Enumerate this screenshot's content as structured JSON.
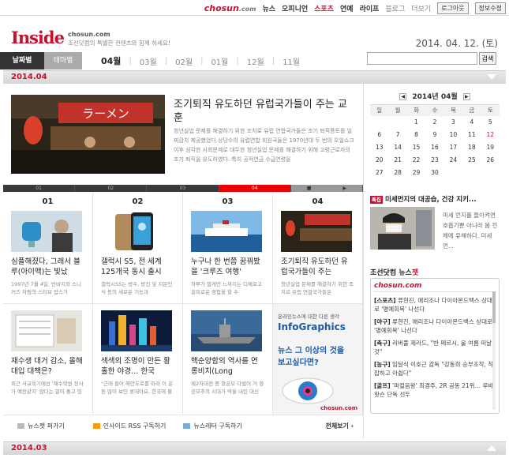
{
  "topbar": {
    "logo_main": "chosun",
    "logo_dot": ".com",
    "nav": [
      "뉴스",
      "오피니언",
      "스포츠",
      "연예",
      "라이프",
      "블로그",
      "더보기"
    ],
    "logout": "로그아웃",
    "profile": "정보수정"
  },
  "header": {
    "brand": "Inside",
    "site": "chosun.com",
    "tagline": "조선닷컴의 특별한 컨텐츠와 함께 하세요!",
    "date": "2014. 04. 12. (토)"
  },
  "tabs": {
    "by_date": "날짜별",
    "by_theme": "테마별",
    "months": [
      "04월",
      "03월",
      "02월",
      "01월",
      "12월",
      "11월"
    ],
    "active_month": "04월",
    "search_placeholder": "",
    "search_button": "검색"
  },
  "section1": {
    "label": "2014.04"
  },
  "feature": {
    "title": "조기퇴직 유도하던 유럽국가들이 주는 교훈",
    "desc": "청년실업 문제를 해결하기 위한 조치로 유럽 연합국가들은 조기 퇴직풍토를 일찌감치 제공했었다.상당수의 유럽연합 회원국들은 1970년대 두 번의 오일쇼크 이후 심각한 사회문제로 대두한 청년실업 문제를 해결하기 위해 고령근로자의 조기 퇴직을 유도하였다. 특히 공적연금 수급연령을"
  },
  "pager": [
    "01",
    "02",
    "03",
    "04",
    "■",
    "▶"
  ],
  "pager_active": 3,
  "articles": [
    {
      "num": "01",
      "title": "심플해졌다, 그래서 블루(아이맥)는 빛났",
      "desc": "1997년 7월 4일, 빈바지와 스니커즈 차림의 스티브 잡스가"
    },
    {
      "num": "02",
      "title": "갤럭시 S5, 전 세계 125개국 동시 출시",
      "desc": "갤럭시S5는 방수, 방진 및 지문인식 등의 새로운 기능과"
    },
    {
      "num": "03",
      "title": "누구나 한 번쯤 꿈꿔봤을 '크루즈 여행'",
      "desc": "하루가 멀게만 느껴지는 디채로고 흥미로운 경험을 할 수"
    },
    {
      "num": "04",
      "title": "조기퇴직 유도하던 유럽국가들이 주는",
      "desc": "청년실업 문제를 해결하기 위한 조치로 유럽 연합국가들은"
    },
    {
      "num": "",
      "title": "재수생 대거 감소, 올해 대입 대책은?",
      "desc": "최근 사교육기에선 '재수학원 장사가 예전같지' 않다는 말이 돌고 있다 정시 추가합격자가"
    },
    {
      "num": "",
      "title": "색색의 조명이 만든 황홀한 야경… 한국",
      "desc": "\"근래 들어 해안도로를 따라 이 운동 많이 보인 롯데아요, 한국에 불어 오는 생선 밀린 곧"
    },
    {
      "num": "",
      "title": "핵순양함의 역사를 연 롱비치(Long",
      "desc": "제2차대전 중 항공모 다벌어 거 항공모추의 시대가 막을 내린 대신 미사일로 중무장한 순양"
    },
    {
      "num": "",
      "title": "",
      "desc": ""
    }
  ],
  "ad": {
    "line1": "온라인뉴스에 대한 다른 생각",
    "brand": "InfoGraphics",
    "slogan1": "뉴스 그 이상의 것을",
    "slogan2": "보고싶다면?",
    "site": "chosun.com"
  },
  "footer_links": [
    "뉴스젯 퍼가기",
    "인사이드 RSS 구독하기",
    "뉴스레터 구독하기",
    "전체보기"
  ],
  "section2": {
    "label": "2014.03"
  },
  "calendar": {
    "title": "2014년 04월",
    "prev": "◀",
    "next": "▶",
    "days": [
      "일",
      "월",
      "화",
      "수",
      "목",
      "금",
      "토"
    ],
    "weeks": [
      [
        "",
        "",
        "1",
        "2",
        "3",
        "4",
        "5"
      ],
      [
        "6",
        "7",
        "8",
        "9",
        "10",
        "11",
        "12"
      ],
      [
        "13",
        "14",
        "15",
        "16",
        "17",
        "18",
        "19"
      ],
      [
        "20",
        "21",
        "22",
        "23",
        "24",
        "25",
        "26"
      ],
      [
        "27",
        "28",
        "29",
        "30",
        "",
        "",
        ""
      ]
    ]
  },
  "side_news": {
    "tag": "특집",
    "title": "미세먼지의 대공습, 건강 지키...",
    "desc": "미세 먼지를 들이켜면 호흡기뿐 아니라 몸 전체에 유해하다. 미세 먼..."
  },
  "newsjet": {
    "title1": "조선닷컴 뉴스",
    "title2": "젯",
    "logo": "chosun.com",
    "items": [
      {
        "cat": "[스포츠]",
        "text": "류현진, 애리조나 다이아몬드백스 상대로 '명예회복' 나선다"
      },
      {
        "cat": "[야구]",
        "text": "류현진, 애리조나 다이아몬드백스 상대로 '명예회복' 나선다"
      },
      {
        "cat": "[축구]",
        "text": "리버풀 제라드, \"반 페르시, 올 여름 떠날 것\""
      },
      {
        "cat": "[농구]",
        "text": "임달식 이호근 감독 \"강동희 승부조작, 착잡하고 아쉽다\""
      },
      {
        "cat": "[골프]",
        "text": "'퍼컬음왕' 최경주, 2R 공동 21위… 루바 왓슨 단독 선두"
      }
    ]
  }
}
